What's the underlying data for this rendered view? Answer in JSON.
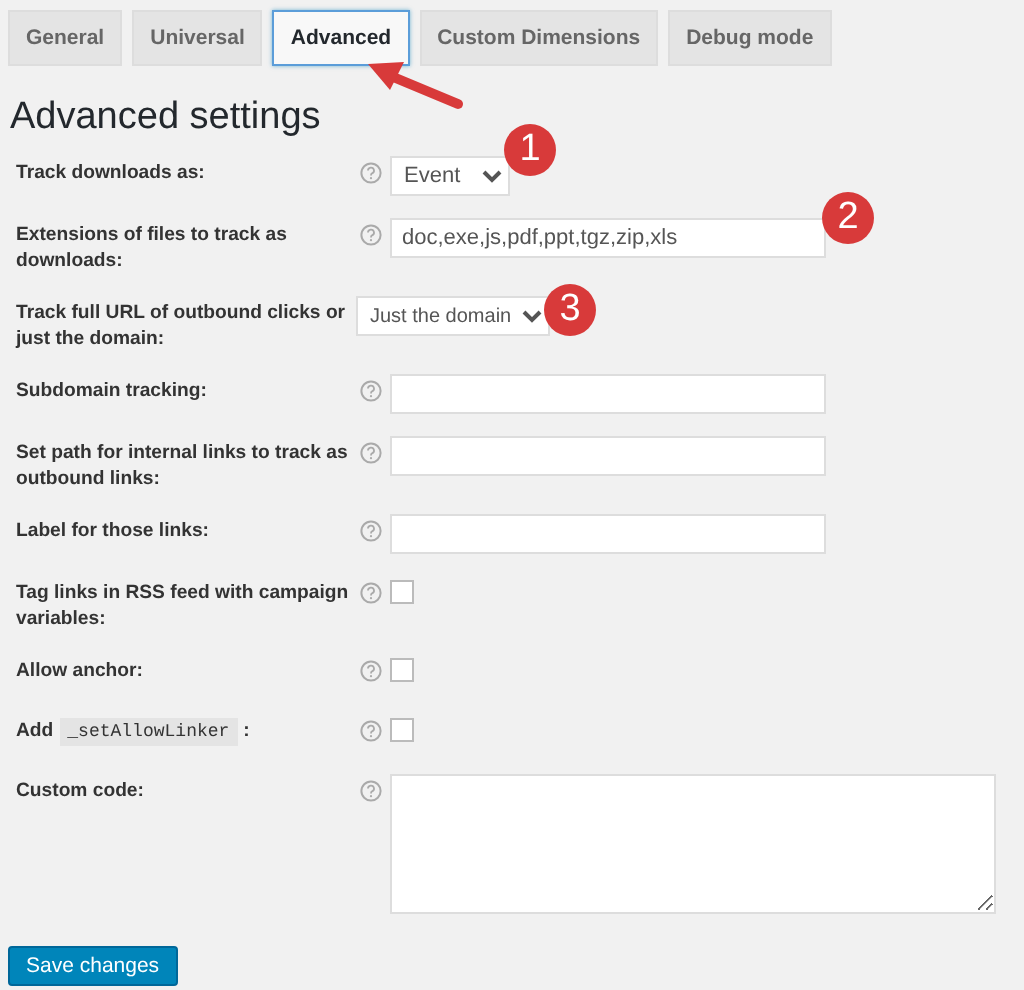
{
  "tabs": [
    {
      "label": "General",
      "selected": false
    },
    {
      "label": "Universal",
      "selected": false
    },
    {
      "label": "Advanced",
      "selected": true
    },
    {
      "label": "Custom Dimensions",
      "selected": false
    },
    {
      "label": "Debug mode",
      "selected": false
    }
  ],
  "heading": "Advanced settings",
  "settings": [
    {
      "kind": "select",
      "label": "Track downloads as:",
      "help": true,
      "value": "Event"
    },
    {
      "kind": "text",
      "label": "Extensions of files to track as downloads:",
      "help": true,
      "value": "doc,exe,js,pdf,ppt,tgz,zip,xls"
    },
    {
      "kind": "select",
      "label": "Track full URL of outbound clicks or just the domain:",
      "help": false,
      "value": "Just the domain"
    },
    {
      "kind": "text",
      "label": "Subdomain tracking:",
      "help": true
    },
    {
      "kind": "text",
      "label": "Set path for internal links to track as outbound links:",
      "help": true
    },
    {
      "kind": "text",
      "label": "Label for those links:",
      "help": true
    },
    {
      "kind": "checkbox",
      "label": "Tag links in RSS feed with campaign variables:",
      "help": true,
      "checked": false
    },
    {
      "kind": "checkbox",
      "label": "Allow anchor:",
      "help": true,
      "checked": false
    },
    {
      "kind": "checkbox",
      "label": "Add",
      "code": "_setAllowLinker",
      "suffix": ":",
      "help": true,
      "checked": false
    },
    {
      "kind": "textarea",
      "label": "Custom code:",
      "help": true
    }
  ],
  "save_button": "Save changes",
  "annotations": [
    {
      "label": "1"
    },
    {
      "label": "2"
    },
    {
      "label": "3"
    }
  ]
}
